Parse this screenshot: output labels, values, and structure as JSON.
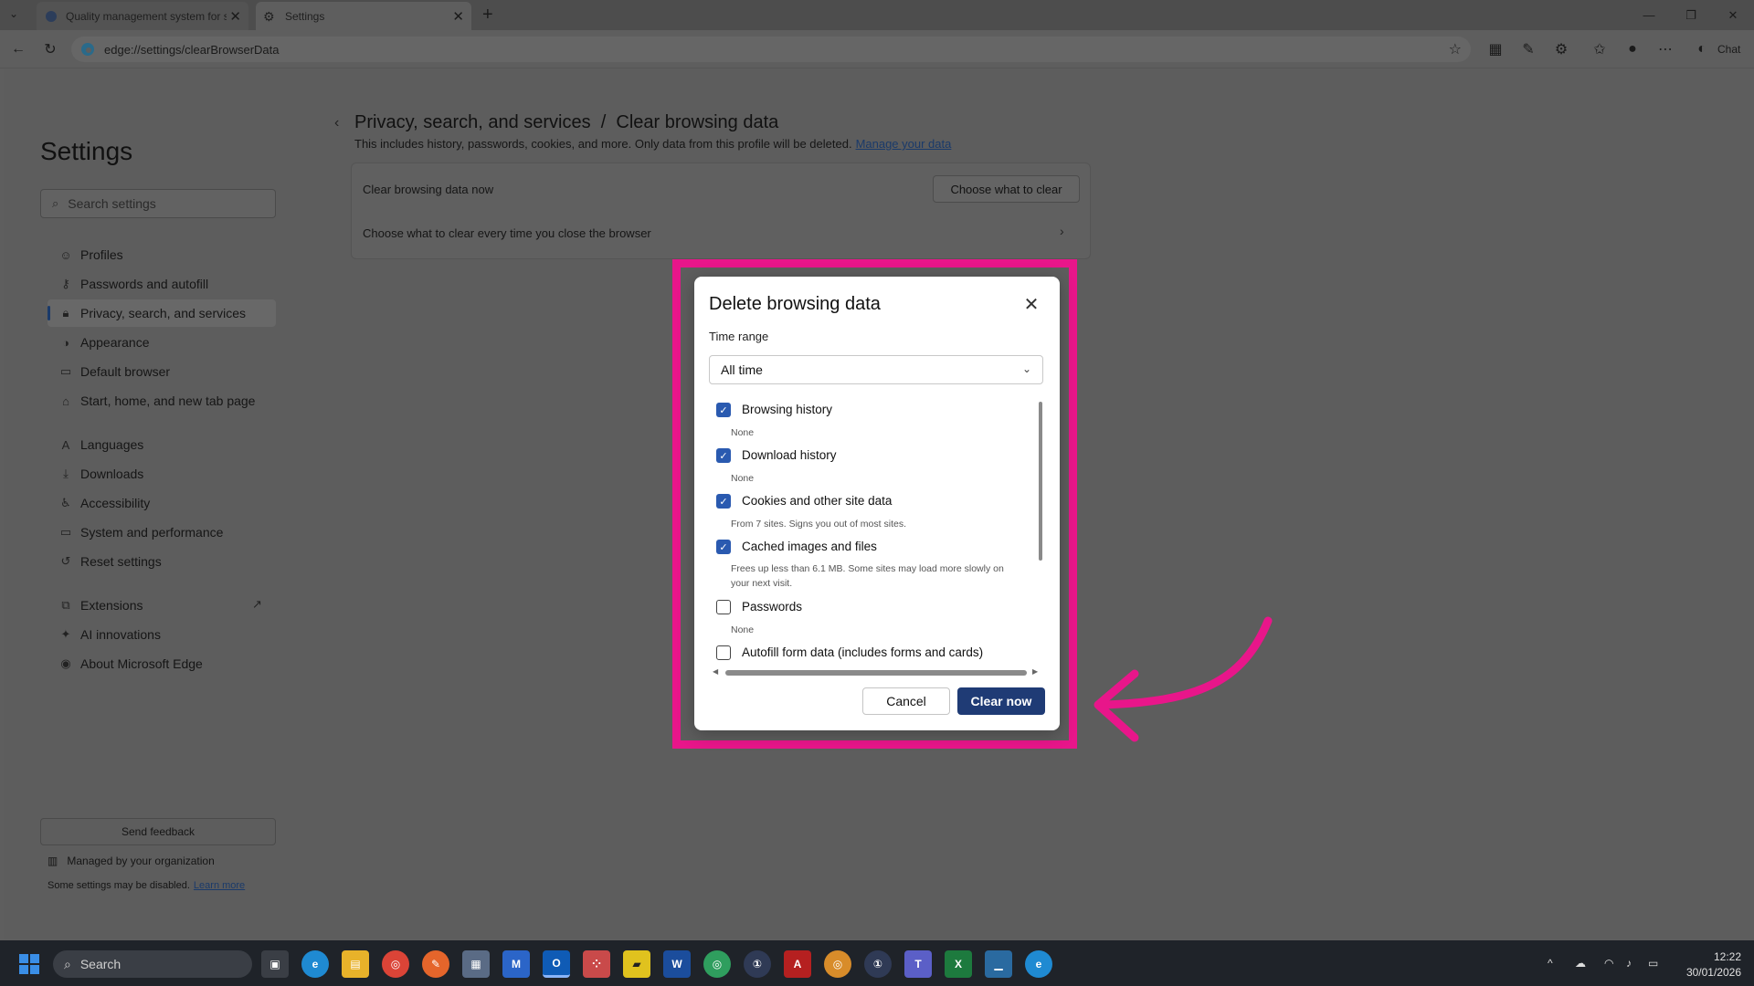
{
  "browser": {
    "tabs": [
      {
        "title": "Quality management system for s"
      },
      {
        "title": "Settings"
      }
    ],
    "url": "edge://settings/clearBrowserData",
    "chat_label": "Chat"
  },
  "settings": {
    "title": "Settings",
    "search_placeholder": "Search settings",
    "nav": [
      {
        "label": "Profiles",
        "icon": "profile-icon"
      },
      {
        "label": "Passwords and autofill",
        "icon": "key-icon"
      },
      {
        "label": "Privacy, search, and services",
        "icon": "lock-icon"
      },
      {
        "label": "Appearance",
        "icon": "appearance-icon"
      },
      {
        "label": "Default browser",
        "icon": "browser-icon"
      },
      {
        "label": "Start, home, and new tab page",
        "icon": "home-icon"
      },
      {
        "label": "Languages",
        "icon": "languages-icon"
      },
      {
        "label": "Downloads",
        "icon": "download-icon"
      },
      {
        "label": "Accessibility",
        "icon": "accessibility-icon"
      },
      {
        "label": "System and performance",
        "icon": "system-icon"
      },
      {
        "label": "Reset settings",
        "icon": "reset-icon"
      },
      {
        "label": "Extensions",
        "icon": "extensions-icon"
      },
      {
        "label": "AI innovations",
        "icon": "ai-icon"
      },
      {
        "label": "About Microsoft Edge",
        "icon": "edge-icon"
      }
    ],
    "feedback_label": "Send feedback",
    "managed_label": "Managed by your organization",
    "some_disabled": "Some settings may be disabled.",
    "learn_more": "Learn more"
  },
  "main": {
    "breadcrumb": "Privacy, search, and services  /  Clear browsing data",
    "description": "This includes history, passwords, cookies, and more. Only data from this profile will be deleted.",
    "manage_link": "Manage your data",
    "clear_now_label": "Clear browsing data now",
    "choose_button": "Choose what to clear",
    "choose_every_label": "Choose what to clear every time you close the browser"
  },
  "dialog": {
    "title": "Delete browsing data",
    "time_range_label": "Time range",
    "time_range_value": "All time",
    "items": [
      {
        "label": "Browsing history",
        "sub": "None",
        "checked": true
      },
      {
        "label": "Download history",
        "sub": "None",
        "checked": true
      },
      {
        "label": "Cookies and other site data",
        "sub": "From 7 sites. Signs you out of most sites.",
        "checked": true
      },
      {
        "label": "Cached images and files",
        "sub": "Frees up less than 6.1 MB. Some sites may load more slowly on your next visit.",
        "checked": true
      },
      {
        "label": "Passwords",
        "sub": "None",
        "checked": false
      },
      {
        "label": "Autofill form data (includes forms and cards)",
        "sub": "",
        "checked": false
      }
    ],
    "cancel_label": "Cancel",
    "clear_label": "Clear now"
  },
  "taskbar": {
    "search_label": "Search",
    "time": "12:22",
    "date": "30/01/2026"
  },
  "colors": {
    "highlight": "#e8168a",
    "primary_button": "#1f3b75",
    "checkbox": "#2a5ab0"
  }
}
